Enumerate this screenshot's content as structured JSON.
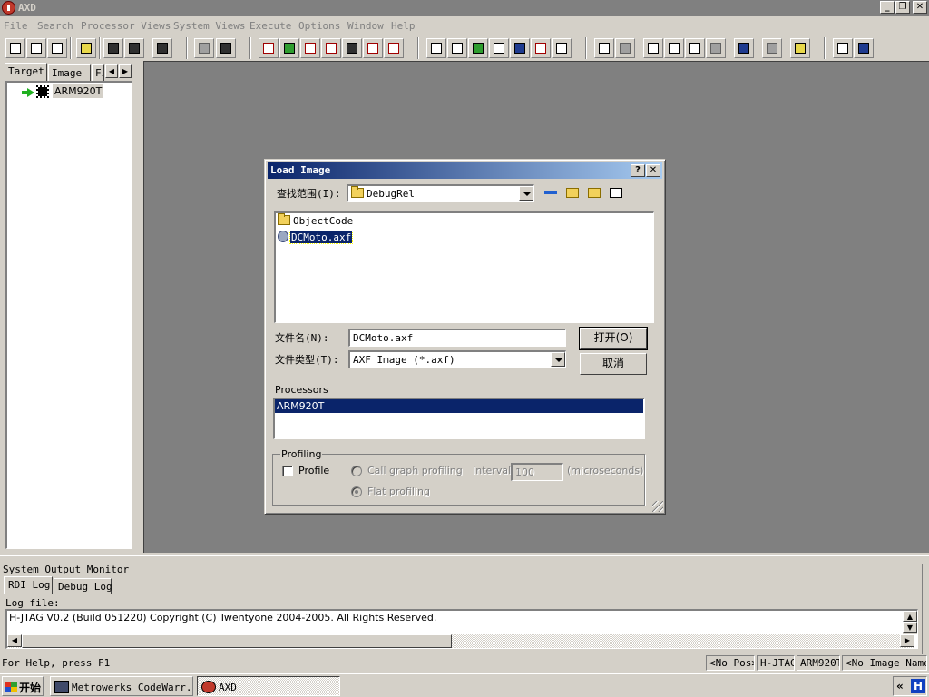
{
  "window": {
    "title": "AXD",
    "minimize": "_",
    "restore": "❐",
    "close": "✕"
  },
  "menu": [
    "File",
    "Search",
    "Processor Views",
    "System Views",
    "Execute",
    "Options",
    "Window",
    "Help"
  ],
  "left_panel": {
    "tabs": [
      "Target",
      "Image",
      "Fi"
    ],
    "tree": {
      "root_label": "ARM920T"
    }
  },
  "dialog": {
    "title": "Load Image",
    "help_btn": "?",
    "close_btn": "✕",
    "look_in_label": "查找范围(I):",
    "look_in_value": "DebugRel",
    "files": [
      {
        "name": "ObjectCode",
        "type": "folder"
      },
      {
        "name": "DCMoto.axf",
        "type": "file",
        "selected": true
      }
    ],
    "filename_label": "文件名(N):",
    "filename_value": "DCMoto.axf",
    "filetype_label": "文件类型(T):",
    "filetype_value": "AXF Image (*.axf)",
    "open_button": "打开(O)",
    "cancel_button": "取消",
    "processors_label": "Processors",
    "processors": [
      "ARM920T"
    ],
    "profiling_label": "Profiling",
    "profile_checkbox": "Profile",
    "callgraph_radio": "Call graph profiling",
    "flat_radio": "Flat profiling",
    "interval_label": "Interval:",
    "interval_value": "100",
    "interval_unit": "(microseconds)"
  },
  "output": {
    "title": "System Output Monitor",
    "tabs": [
      "RDI Log",
      "Debug Log"
    ],
    "logfile_label": "Log file:",
    "log_text": "H-JTAG V0.2 (Build 051220) Copyright (C) Twentyone 2004-2005. All Rights Reserved."
  },
  "status": {
    "help": "For Help, press F1",
    "panels": [
      "<No Pos>",
      "H-JTAG",
      "ARM920T",
      "<No Image Name>"
    ]
  },
  "taskbar": {
    "start": "开始",
    "tasks": [
      "Metrowerks CodeWarr...",
      "AXD"
    ],
    "tray_chevron": "«",
    "tray_icon_letter": "H"
  }
}
